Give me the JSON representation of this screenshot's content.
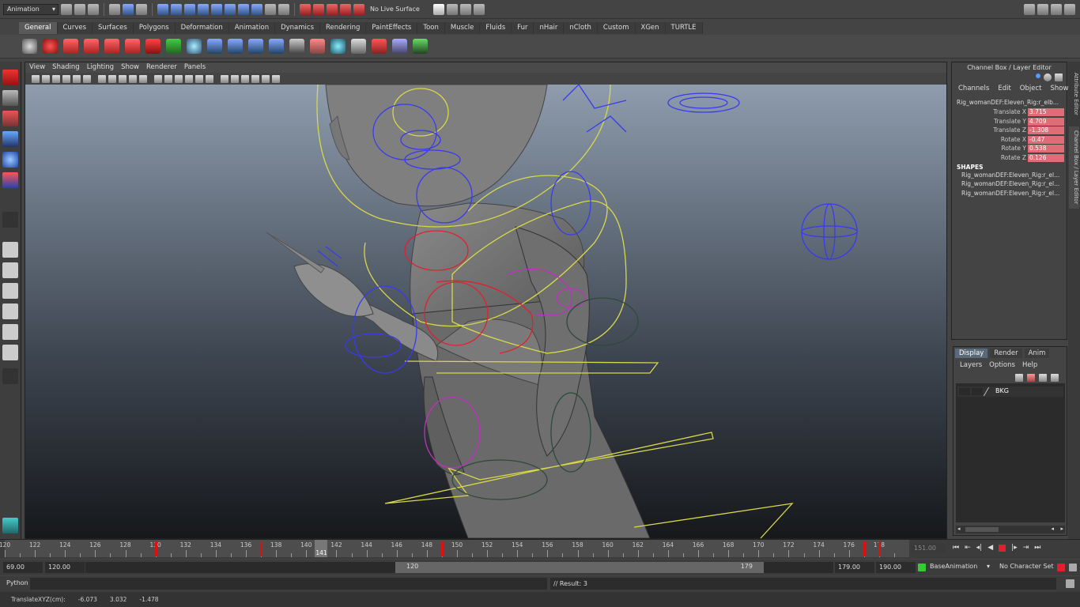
{
  "status_line": {
    "mode": "Animation",
    "live_surface": "No Live Surface"
  },
  "shelf": {
    "tabs": [
      "General",
      "Curves",
      "Surfaces",
      "Polygons",
      "Deformation",
      "Animation",
      "Dynamics",
      "Rendering",
      "PaintEffects",
      "Toon",
      "Muscle",
      "Fluids",
      "Fur",
      "nHair",
      "nCloth",
      "Custom",
      "XGen",
      "TURTLE"
    ],
    "active_tab": "General"
  },
  "viewport": {
    "menu": [
      "View",
      "Shading",
      "Lighting",
      "Show",
      "Renderer",
      "Panels"
    ]
  },
  "channel_box": {
    "title": "Channel Box / Layer Editor",
    "menu": [
      "Channels",
      "Edit",
      "Object",
      "Show"
    ],
    "node": "Rig_womanDEF:Eleven_Rig:r_elb...",
    "attributes": [
      {
        "name": "Translate X",
        "value": "3.715"
      },
      {
        "name": "Translate Y",
        "value": "4.709"
      },
      {
        "name": "Translate Z",
        "value": "-1.308"
      },
      {
        "name": "Rotate X",
        "value": "-0.47"
      },
      {
        "name": "Rotate Y",
        "value": "0.538"
      },
      {
        "name": "Rotate Z",
        "value": "0.126"
      }
    ],
    "shapes_header": "SHAPES",
    "shapes": [
      "Rig_womanDEF:Eleven_Rig:r_el...",
      "Rig_womanDEF:Eleven_Rig:r_el...",
      "Rig_womanDEF:Eleven_Rig:r_el..."
    ]
  },
  "side_tabs": [
    "Attribute Editor",
    "Channel Box / Layer Editor"
  ],
  "layer_editor": {
    "tabs": [
      "Display",
      "Render",
      "Anim"
    ],
    "active_tab": "Display",
    "menu": [
      "Layers",
      "Options",
      "Help"
    ],
    "layers": [
      {
        "name": "BKG"
      }
    ]
  },
  "time_slider": {
    "ticks": [
      "120",
      "122",
      "124",
      "126",
      "128",
      "130",
      "132",
      "134",
      "136",
      "138",
      "140",
      "142",
      "144",
      "146",
      "148",
      "150",
      "152",
      "154",
      "156",
      "158",
      "160",
      "162",
      "164",
      "166",
      "168",
      "170",
      "172",
      "174",
      "176",
      "178"
    ],
    "current_frame": "141",
    "end_display": "151.00",
    "keyframes": [
      130,
      137,
      149,
      177,
      178
    ]
  },
  "range_slider": {
    "anim_start": "69.00",
    "range_start": "120.00",
    "inner_start": "120",
    "inner_end": "179",
    "range_end": "179.00",
    "anim_end": "190.00",
    "anim_layer": "BaseAnimation",
    "character_set": "No Character Set"
  },
  "command_line": {
    "language": "Python",
    "result": "// Result: 3"
  },
  "help_line": {
    "label": "TranslateXYZ(cm):",
    "x": "-6.073",
    "y": "3.032",
    "z": "-1.478"
  },
  "colors": {
    "key_red": "#e01010",
    "attr_highlight": "#e06c78",
    "rig_yellow": "#d8d84a",
    "rig_blue": "#3a3aee",
    "rig_red": "#e02030",
    "rig_magenta": "#c030c0"
  }
}
